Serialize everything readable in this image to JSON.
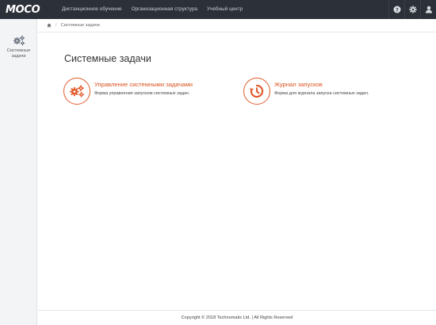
{
  "brand": {
    "logo_text": "MOCO"
  },
  "nav": {
    "items": [
      {
        "label": "Дистанционное обучение"
      },
      {
        "label": "Организационная структура"
      },
      {
        "label": "Учебный центр"
      }
    ],
    "right_icons": [
      "help-icon",
      "gear-icon",
      "user-icon"
    ]
  },
  "sidebar": {
    "items": [
      {
        "label": "Системные задачи",
        "icon": "gears-icon"
      }
    ]
  },
  "breadcrumb": {
    "home_icon": "home-icon",
    "separator": "/",
    "current": "Системные задачи"
  },
  "page": {
    "title": "Системные задачи",
    "cards": [
      {
        "title": "Управление системными задачами",
        "description": "Форма управления запуском системных задач.",
        "icon": "gears-icon"
      },
      {
        "title": "Журнал запусков",
        "description": "Форма для журнала запуска системных задач.",
        "icon": "history-icon"
      }
    ]
  },
  "footer": {
    "text": "Copyright © 2018 Technomatix Ltd. | All Rights Reserved"
  },
  "colors": {
    "navbar": "#2c3038",
    "accent": "#e05a2b",
    "sidebar": "#f3f4f6"
  }
}
